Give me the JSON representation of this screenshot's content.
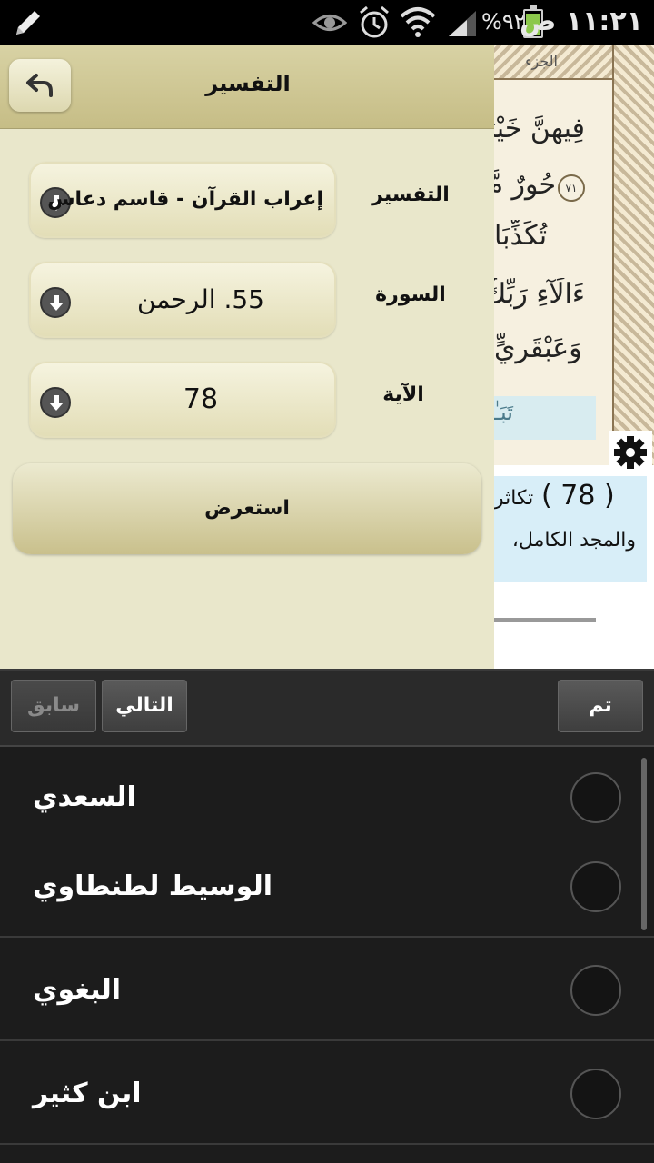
{
  "status_bar": {
    "time": "١١:٢١ ص",
    "battery_percent": "٩٢%",
    "battery_level": 0.92,
    "icons": [
      "pencil-icon",
      "eye-icon",
      "alarm-icon",
      "wifi-icon",
      "signal-icon",
      "battery-icon"
    ]
  },
  "quran_page": {
    "juz_label": "الجزء",
    "lines": [
      "فِيهِنَّ خَيْرَ",
      "حُورٌ مَّ",
      "تُكَذِّبَا",
      "ءَالَآءِ رَبِّكُ",
      "وَعَبْقَرِيٍّ"
    ],
    "ayah_marker": "٧١",
    "highlight_text": "تَبَـٰ",
    "tafsir_number": "( 78 )",
    "tafsir_word": "تكاثر",
    "tafsir_line2": "والمجد الكامل،"
  },
  "panel": {
    "title": "التفسير",
    "fields": {
      "tafsir": {
        "label": "التفسير",
        "value": "إعراب القرآن - قاسم دعاس"
      },
      "surah": {
        "label": "السورة",
        "value": "55. الرحمن"
      },
      "ayah": {
        "label": "الآية",
        "value": "78"
      }
    },
    "show_button": "استعرض"
  },
  "picker": {
    "toolbar": {
      "prev": "سابق",
      "next": "التالي",
      "done": "تم"
    },
    "items": [
      {
        "label": "السعدي",
        "selected": false
      },
      {
        "label": "الوسيط لطنطاوي",
        "selected": false
      },
      {
        "label": "البغوي",
        "selected": false
      },
      {
        "label": "ابن كثير",
        "selected": false
      }
    ]
  },
  "colors": {
    "panel_bg": "#e9e7cb",
    "header_bg": "#c6bd86",
    "picker_bg": "#1c1c1c",
    "tafsir_highlight": "#d8eef8"
  }
}
